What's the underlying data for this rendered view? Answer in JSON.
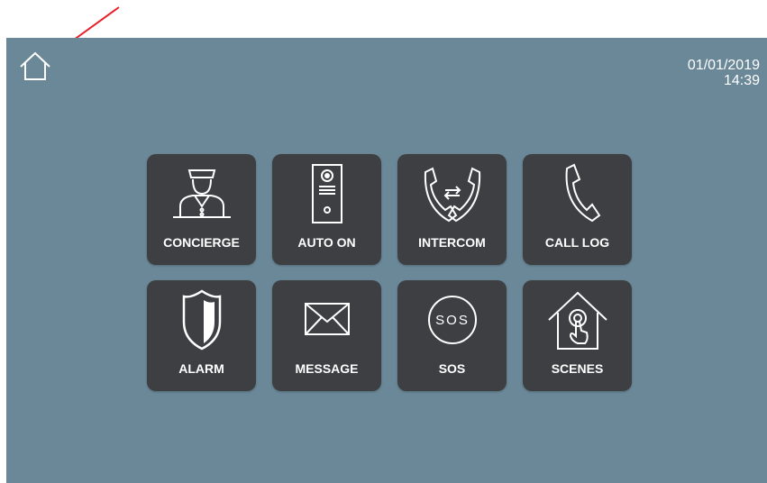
{
  "header": {
    "home_icon": "home-icon",
    "date": "01/01/2019",
    "time": "14:39"
  },
  "tiles": [
    {
      "label": "CONCIERGE",
      "icon": "concierge-icon"
    },
    {
      "label": "AUTO ON",
      "icon": "door-station-icon"
    },
    {
      "label": "INTERCOM",
      "icon": "intercom-icon"
    },
    {
      "label": "CALL LOG",
      "icon": "phone-icon"
    },
    {
      "label": "ALARM",
      "icon": "shield-icon"
    },
    {
      "label": "MESSAGE",
      "icon": "envelope-icon"
    },
    {
      "label": "SOS",
      "icon": "sos-icon"
    },
    {
      "label": "SCENES",
      "icon": "smart-home-icon"
    }
  ],
  "annotation": {
    "arrow_color": "#e8202a"
  },
  "colors": {
    "screen_bg": "#6b8898",
    "tile_bg": "#3d3f42",
    "text": "#ffffff"
  }
}
